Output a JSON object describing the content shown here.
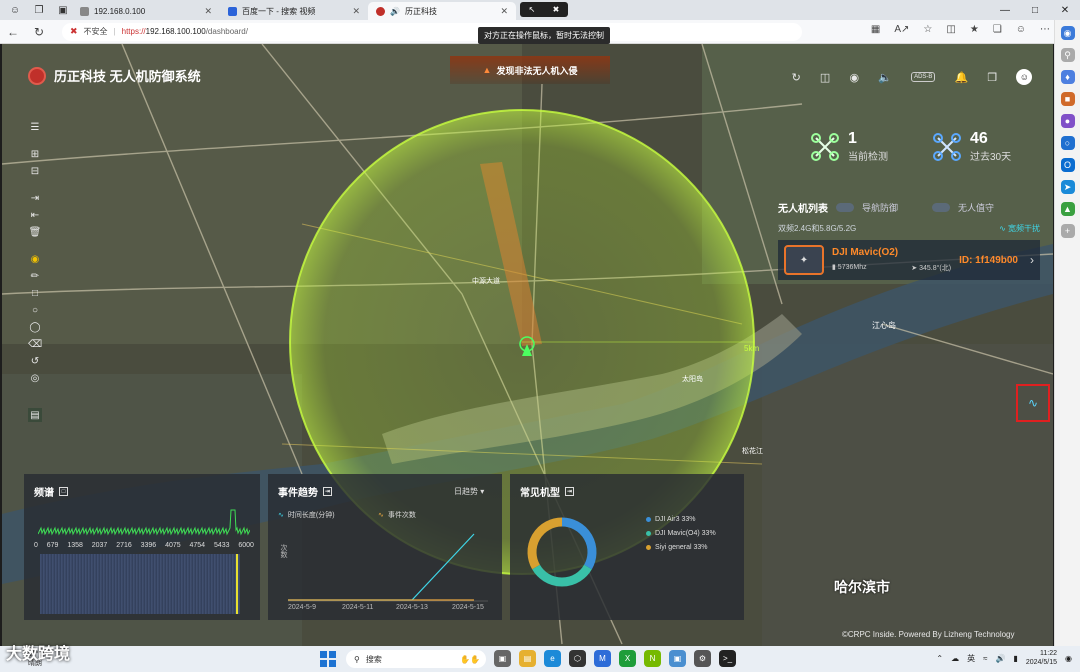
{
  "browser": {
    "tabs": [
      {
        "title": "192.168.0.100",
        "active": false
      },
      {
        "title": "百度一下 - 搜索 视频",
        "active": false
      },
      {
        "title": "历正科技",
        "active": true
      }
    ],
    "address": {
      "security_label": "不安全",
      "protocol": "https://",
      "host": "192.168.100.100",
      "path": "/dashboard/"
    },
    "remote_tooltip": "对方正在操作鼠标，暂时无法控制"
  },
  "app": {
    "title": "历正科技 无人机防御系统",
    "alert": "发现非法无人机入侵",
    "top_icons": [
      "refresh-icon",
      "map-icon",
      "eye-icon",
      "speaker-icon",
      "ADS-B",
      "bell-icon",
      "layers-icon",
      "user-icon"
    ],
    "stats": {
      "current": {
        "value": "1",
        "label": "当前检测"
      },
      "past30": {
        "value": "46",
        "label": "过去30天"
      }
    },
    "uav_list": {
      "title": "无人机列表",
      "toggle_nav": "导航防御",
      "toggle_guard": "无人值守",
      "band": "双频2.4G和5.8G/5.2G",
      "jam": "宽频干扰",
      "items": [
        {
          "name": "DJI Mavic(O2)",
          "freq": "5736Mhz",
          "bearing": "345.8°(北)",
          "id": "ID: 1f149b00"
        }
      ]
    },
    "map": {
      "city": "哈尔滨市",
      "ring_label": "5km",
      "copyright": "©CRPC Inside. Powered By Lizheng Technology",
      "place_labels": [
        "中源大道",
        "江心岛",
        "松花江",
        "太阳岛"
      ]
    },
    "spectrum": {
      "title": "频谱",
      "ticks": [
        "0",
        "679",
        "1358",
        "2037",
        "2716",
        "3396",
        "4075",
        "4754",
        "5433",
        "6000"
      ]
    },
    "events": {
      "title": "事件趋势",
      "range": "日趋势 ▾",
      "legend": [
        "时间长度(分钟)",
        "事件次数"
      ],
      "ylabel": "次数",
      "x_labels": [
        "2024-5-9",
        "2024-5-11",
        "2024-5-13",
        "2024-5-15"
      ]
    },
    "models": {
      "title": "常见机型"
    }
  },
  "taskbar": {
    "weather_temp": "15°C",
    "weather_text": "晴朗",
    "watermark": "大数跨境",
    "search": "搜索",
    "ime": "英",
    "time": "11:22",
    "date": "2024/5/15"
  },
  "chart_data": [
    {
      "type": "pie",
      "title": "常见机型",
      "categories": [
        "DJI Air3",
        "DJI Mavic(O4)",
        "Siyi general"
      ],
      "values": [
        33,
        33,
        33
      ],
      "labels": [
        "DJI Air3 33%",
        "DJI Mavic(O4) 33%",
        "Siyi general 33%"
      ],
      "colors": [
        "#3a8fd8",
        "#39c0a8",
        "#d8a030"
      ]
    },
    {
      "type": "line",
      "title": "事件趋势",
      "x": [
        "2024-5-9",
        "2024-5-11",
        "2024-5-13",
        "2024-5-15"
      ],
      "series": [
        {
          "name": "时间长度(分钟)",
          "values": [
            0,
            0,
            0,
            6
          ],
          "color": "#3fd6e8"
        },
        {
          "name": "事件次数",
          "values": [
            0,
            0,
            0,
            0
          ],
          "color": "#e8a640"
        }
      ]
    }
  ]
}
